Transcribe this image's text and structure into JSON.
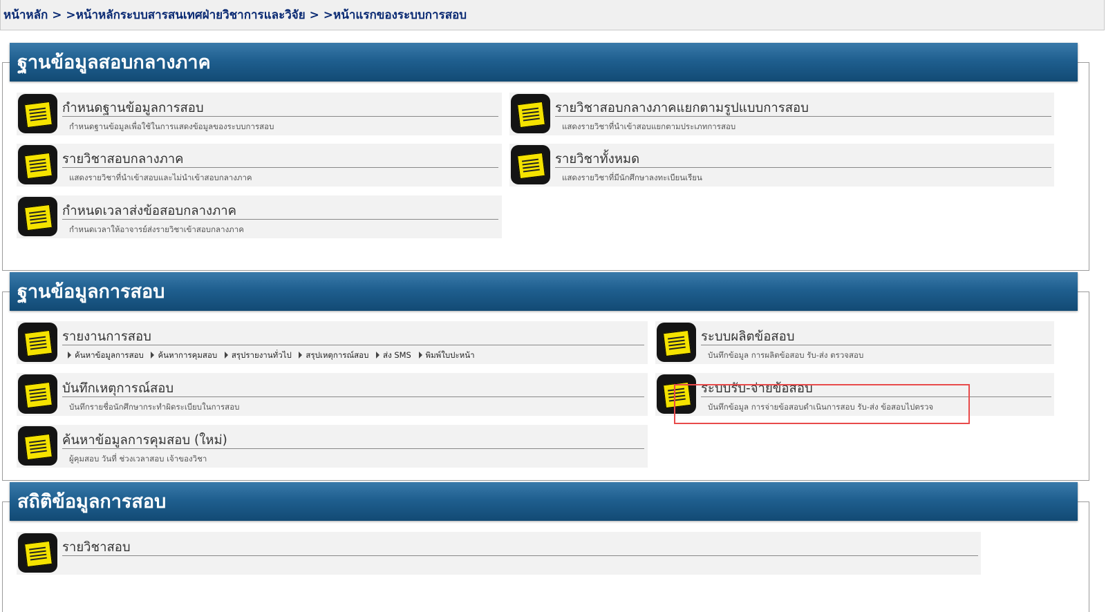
{
  "breadcrumb": {
    "home": "หน้าหลัก",
    "sep": " > ",
    "level1": ">หน้าหลักระบบสารสนเทศฝ่ายวิชาการและวิจัย",
    "level2": ">หน้าแรกของระบบการสอบ"
  },
  "sections": [
    {
      "title": "ฐานข้อมูลสอบกลางภาค",
      "items": [
        {
          "title": "กำหนดฐานข้อมูลการสอบ",
          "desc": "กำหนดฐานข้อมูลเพื่อใช้ในการแสดงข้อมูลของระบบการสอบ"
        },
        {
          "title": "รายวิชาสอบกลางภาคแยกตามรูปแบบการสอบ",
          "desc": "แสดงรายวิชาที่นำเข้าสอบแยกตามประเภทการสอบ"
        },
        {
          "title": "รายวิชาสอบกลางภาค",
          "desc": "แสดงรายวิชาที่นำเข้าสอบและไม่นำเข้าสอบกลางภาค"
        },
        {
          "title": "รายวิชาทั้งหมด",
          "desc": "แสดงรายวิชาที่มีนักศึกษาลงทะเบียนเรียน"
        },
        {
          "title": "กำหนดเวลาส่งข้อสอบกลางภาค",
          "desc": "กำหนดเวลาให้อาจารย์ส่งรายวิชาเข้าสอบกลางภาค"
        }
      ]
    },
    {
      "title": "ฐานข้อมูลการสอบ",
      "items": [
        {
          "title": "รายงานการสอบ",
          "links": [
            "ค้นหาข้อมูลการสอบ",
            "ค้นหาการคุมสอบ",
            "สรุปรายงานทั่วไป",
            "สรุปเหตุการณ์สอบ",
            "ส่ง SMS",
            "พิมพ์ใบปะหน้า"
          ]
        },
        {
          "title": "ระบบผลิตข้อสอบ",
          "desc": "บันทึกข้อมูล การผลิตข้อสอบ รับ-ส่ง ตรวจสอบ"
        },
        {
          "title": "บันทึกเหตุการณ์สอบ",
          "desc": "บันทึกรายชื่อนักศึกษากระทำผิดระเบียบในการสอบ"
        },
        {
          "title": "ระบบรับ-จ่ายข้อสอบ",
          "desc": "บันทึกข้อมูล การจ่ายข้อสอบดำเนินการสอบ รับ-ส่ง ข้อสอบไปตรวจ"
        },
        {
          "title": "ค้นหาข้อมูลการคุมสอบ (ใหม่)",
          "desc": "ผู้คุมสอบ วันที่ ช่วงเวลาสอบ เจ้าของวิชา"
        }
      ]
    },
    {
      "title": "สถิติข้อมูลการสอบ",
      "items": [
        {
          "title": "รายวิชาสอบ",
          "desc": ""
        }
      ]
    }
  ],
  "icons": {
    "item_icon": "notepad-icon",
    "link_bullet": "triangle-right-icon"
  },
  "colors": {
    "header": "#1f5f8f",
    "breadcrumb_text": "#0a2a73",
    "note": "#f5e300",
    "highlight": "#e84a4a"
  }
}
